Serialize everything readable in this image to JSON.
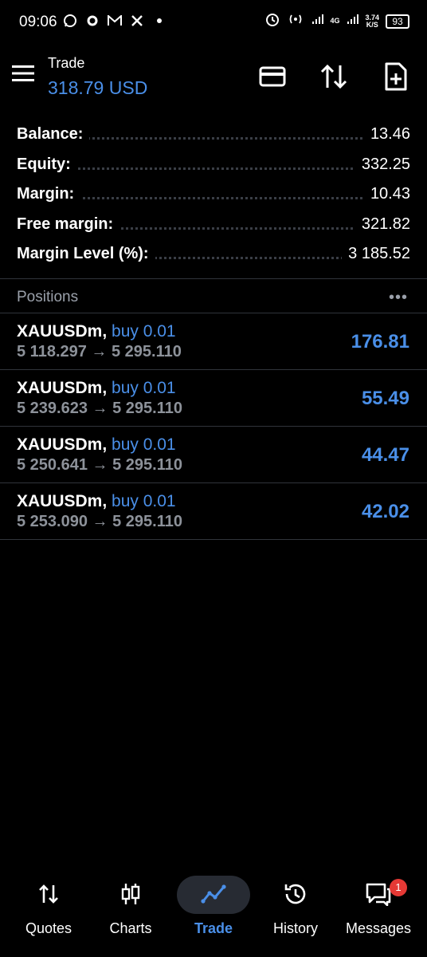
{
  "status_bar": {
    "time": "09:06",
    "network_label": "4G",
    "speed_value": "3.74",
    "speed_unit": "K/S",
    "battery": "93"
  },
  "header": {
    "title": "Trade",
    "balance_summary": "318.79 USD"
  },
  "account": [
    {
      "label": "Balance:",
      "value": "13.46"
    },
    {
      "label": "Equity:",
      "value": "332.25"
    },
    {
      "label": "Margin:",
      "value": "10.43"
    },
    {
      "label": "Free margin:",
      "value": "321.82"
    },
    {
      "label": "Margin Level (%):",
      "value": "3 185.52"
    }
  ],
  "positions_section": {
    "title": "Positions",
    "more": "•••"
  },
  "positions": [
    {
      "symbol": "XAUUSDm,",
      "side": "buy 0.01",
      "prices": "5 118.297 → 5 295.110",
      "profit": "176.81"
    },
    {
      "symbol": "XAUUSDm,",
      "side": "buy 0.01",
      "prices": "5 239.623 → 5 295.110",
      "profit": "55.49"
    },
    {
      "symbol": "XAUUSDm,",
      "side": "buy 0.01",
      "prices": "5 250.641 → 5 295.110",
      "profit": "44.47"
    },
    {
      "symbol": "XAUUSDm,",
      "side": "buy 0.01",
      "prices": "5 253.090 → 5 295.110",
      "profit": "42.02"
    }
  ],
  "bottom_nav": [
    {
      "label": "Quotes",
      "icon": "quotes-arrows-icon"
    },
    {
      "label": "Charts",
      "icon": "candlestick-icon"
    },
    {
      "label": "Trade",
      "icon": "trade-line-icon",
      "active": true
    },
    {
      "label": "History",
      "icon": "history-icon"
    },
    {
      "label": "Messages",
      "icon": "messages-icon",
      "badge": "1"
    }
  ],
  "colors": {
    "accent": "#4a8fe8",
    "background": "#000000",
    "muted": "#8d929a",
    "badge": "#e53935"
  }
}
